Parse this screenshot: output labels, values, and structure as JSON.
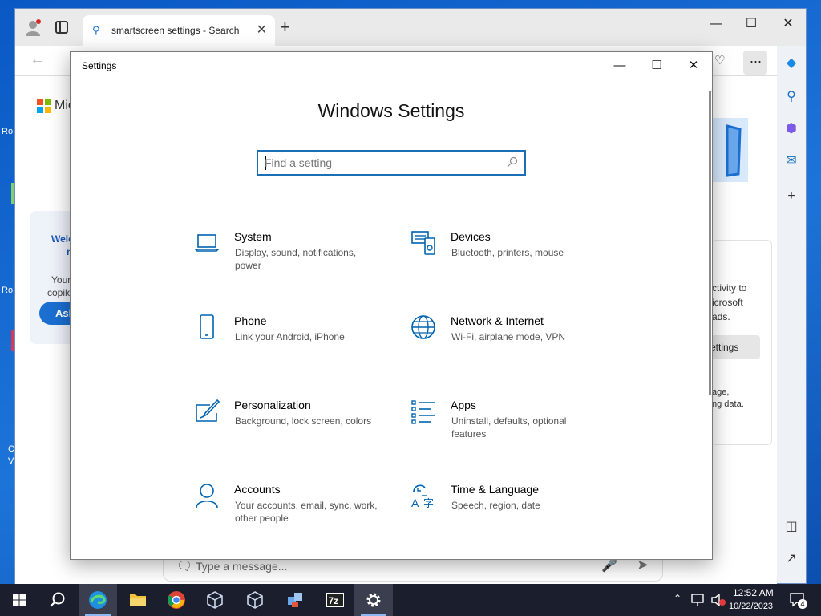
{
  "desktop": {
    "frag_ro1": "Ro",
    "frag_ro2": "Ro",
    "frag_c": "C",
    "frag_v": "V"
  },
  "browser": {
    "tab_title": "smartscreen settings - Search",
    "page": {
      "brand_partial": "Mic",
      "welcome_partial": "Welc",
      "welcome_partial2": "n",
      "left_text": "Your",
      "left_text2": "copilo",
      "ask_label": "Ask",
      "right_text1": "ctivity to",
      "right_text2": "icrosoft",
      "right_text3": "ads.",
      "right_button": "ettings",
      "right_text4": "age,",
      "right_text5": "ng data."
    },
    "message_placeholder": "Type a message..."
  },
  "settings": {
    "window_title": "Settings",
    "heading": "Windows Settings",
    "search_placeholder": "Find a setting",
    "tiles": [
      {
        "name": "System",
        "desc": "Display, sound, notifications, power",
        "icon": "laptop-icon"
      },
      {
        "name": "Devices",
        "desc": "Bluetooth, printers, mouse",
        "icon": "devices-icon"
      },
      {
        "name": "Phone",
        "desc": "Link your Android, iPhone",
        "icon": "phone-icon"
      },
      {
        "name": "Network & Internet",
        "desc": "Wi-Fi, airplane mode, VPN",
        "icon": "globe-icon"
      },
      {
        "name": "Personalization",
        "desc": "Background, lock screen, colors",
        "icon": "paintbrush-icon"
      },
      {
        "name": "Apps",
        "desc": "Uninstall, defaults, optional features",
        "icon": "apps-list-icon"
      },
      {
        "name": "Accounts",
        "desc": "Your accounts, email, sync, work, other people",
        "icon": "person-icon"
      },
      {
        "name": "Time & Language",
        "desc": "Speech, region, date",
        "icon": "time-language-icon"
      }
    ]
  },
  "taskbar": {
    "time": "12:52 AM",
    "date": "10/22/2023",
    "notification_count": "4",
    "apps": [
      "start",
      "search",
      "edge",
      "file-explorer",
      "chrome",
      "virtualbox",
      "virtualbox-2",
      "network-tool",
      "7zip",
      "settings"
    ]
  },
  "colors": {
    "accent": "#0063b1",
    "desktop_bg": "#1466c9",
    "taskbar_bg": "#1b1e2c"
  }
}
